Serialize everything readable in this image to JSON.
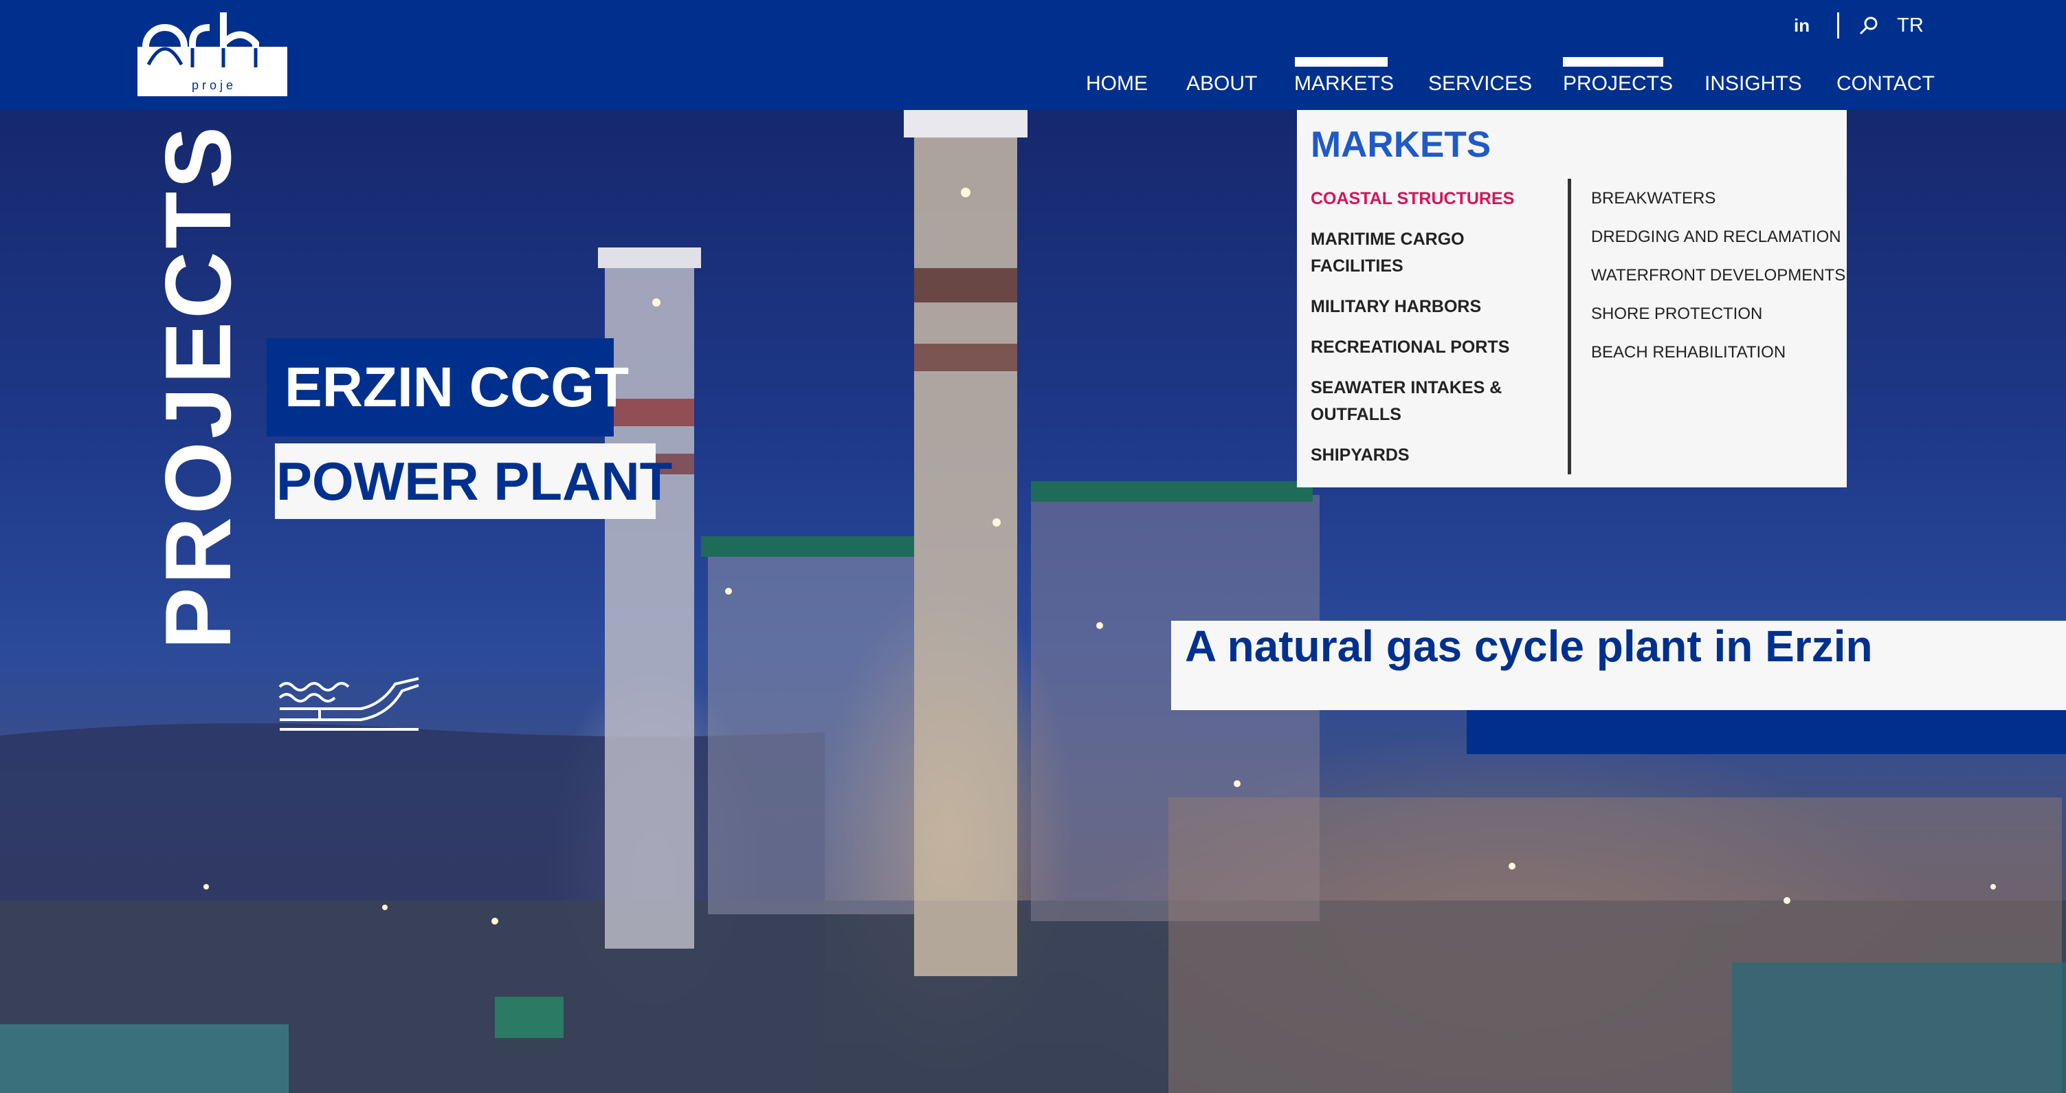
{
  "header": {
    "logo_label": "orh proje",
    "logo_text": "p r o j e",
    "social": {
      "linkedin": "in"
    },
    "language": "TR"
  },
  "nav": {
    "items": [
      "HOME",
      "ABOUT",
      "MARKETS",
      "SERVICES",
      "PROJECTS",
      "INSIGHTS",
      "CONTACT"
    ],
    "active": [
      "MARKETS",
      "PROJECTS"
    ]
  },
  "dropdown": {
    "title": "MARKETS",
    "left_items": [
      "COASTAL STRUCTURES",
      "MARITIME CARGO FACILITIES",
      "MILITARY HARBORS",
      "RECREATIONAL PORTS",
      "SEAWATER INTAKES & OUTFALLS",
      "SHIPYARDS"
    ],
    "active_item": "COASTAL STRUCTURES",
    "right_items": [
      "BREAKWATERS",
      "DREDGING AND RECLAMATION",
      "WATERFRONT DEVELOPMENTS",
      "SHORE PROTECTION",
      "BEACH REHABILITATION"
    ]
  },
  "hero": {
    "section_label": "PROJECTS",
    "title_line1": "ERZIN CCGT",
    "title_line2": "POWER PLANT",
    "tagline": "A natural gas cycle plant in Erzin"
  },
  "colors": {
    "brand_blue": "#00308e",
    "menu_title_blue": "#1f5ac8",
    "active_pink": "#d4145a"
  }
}
